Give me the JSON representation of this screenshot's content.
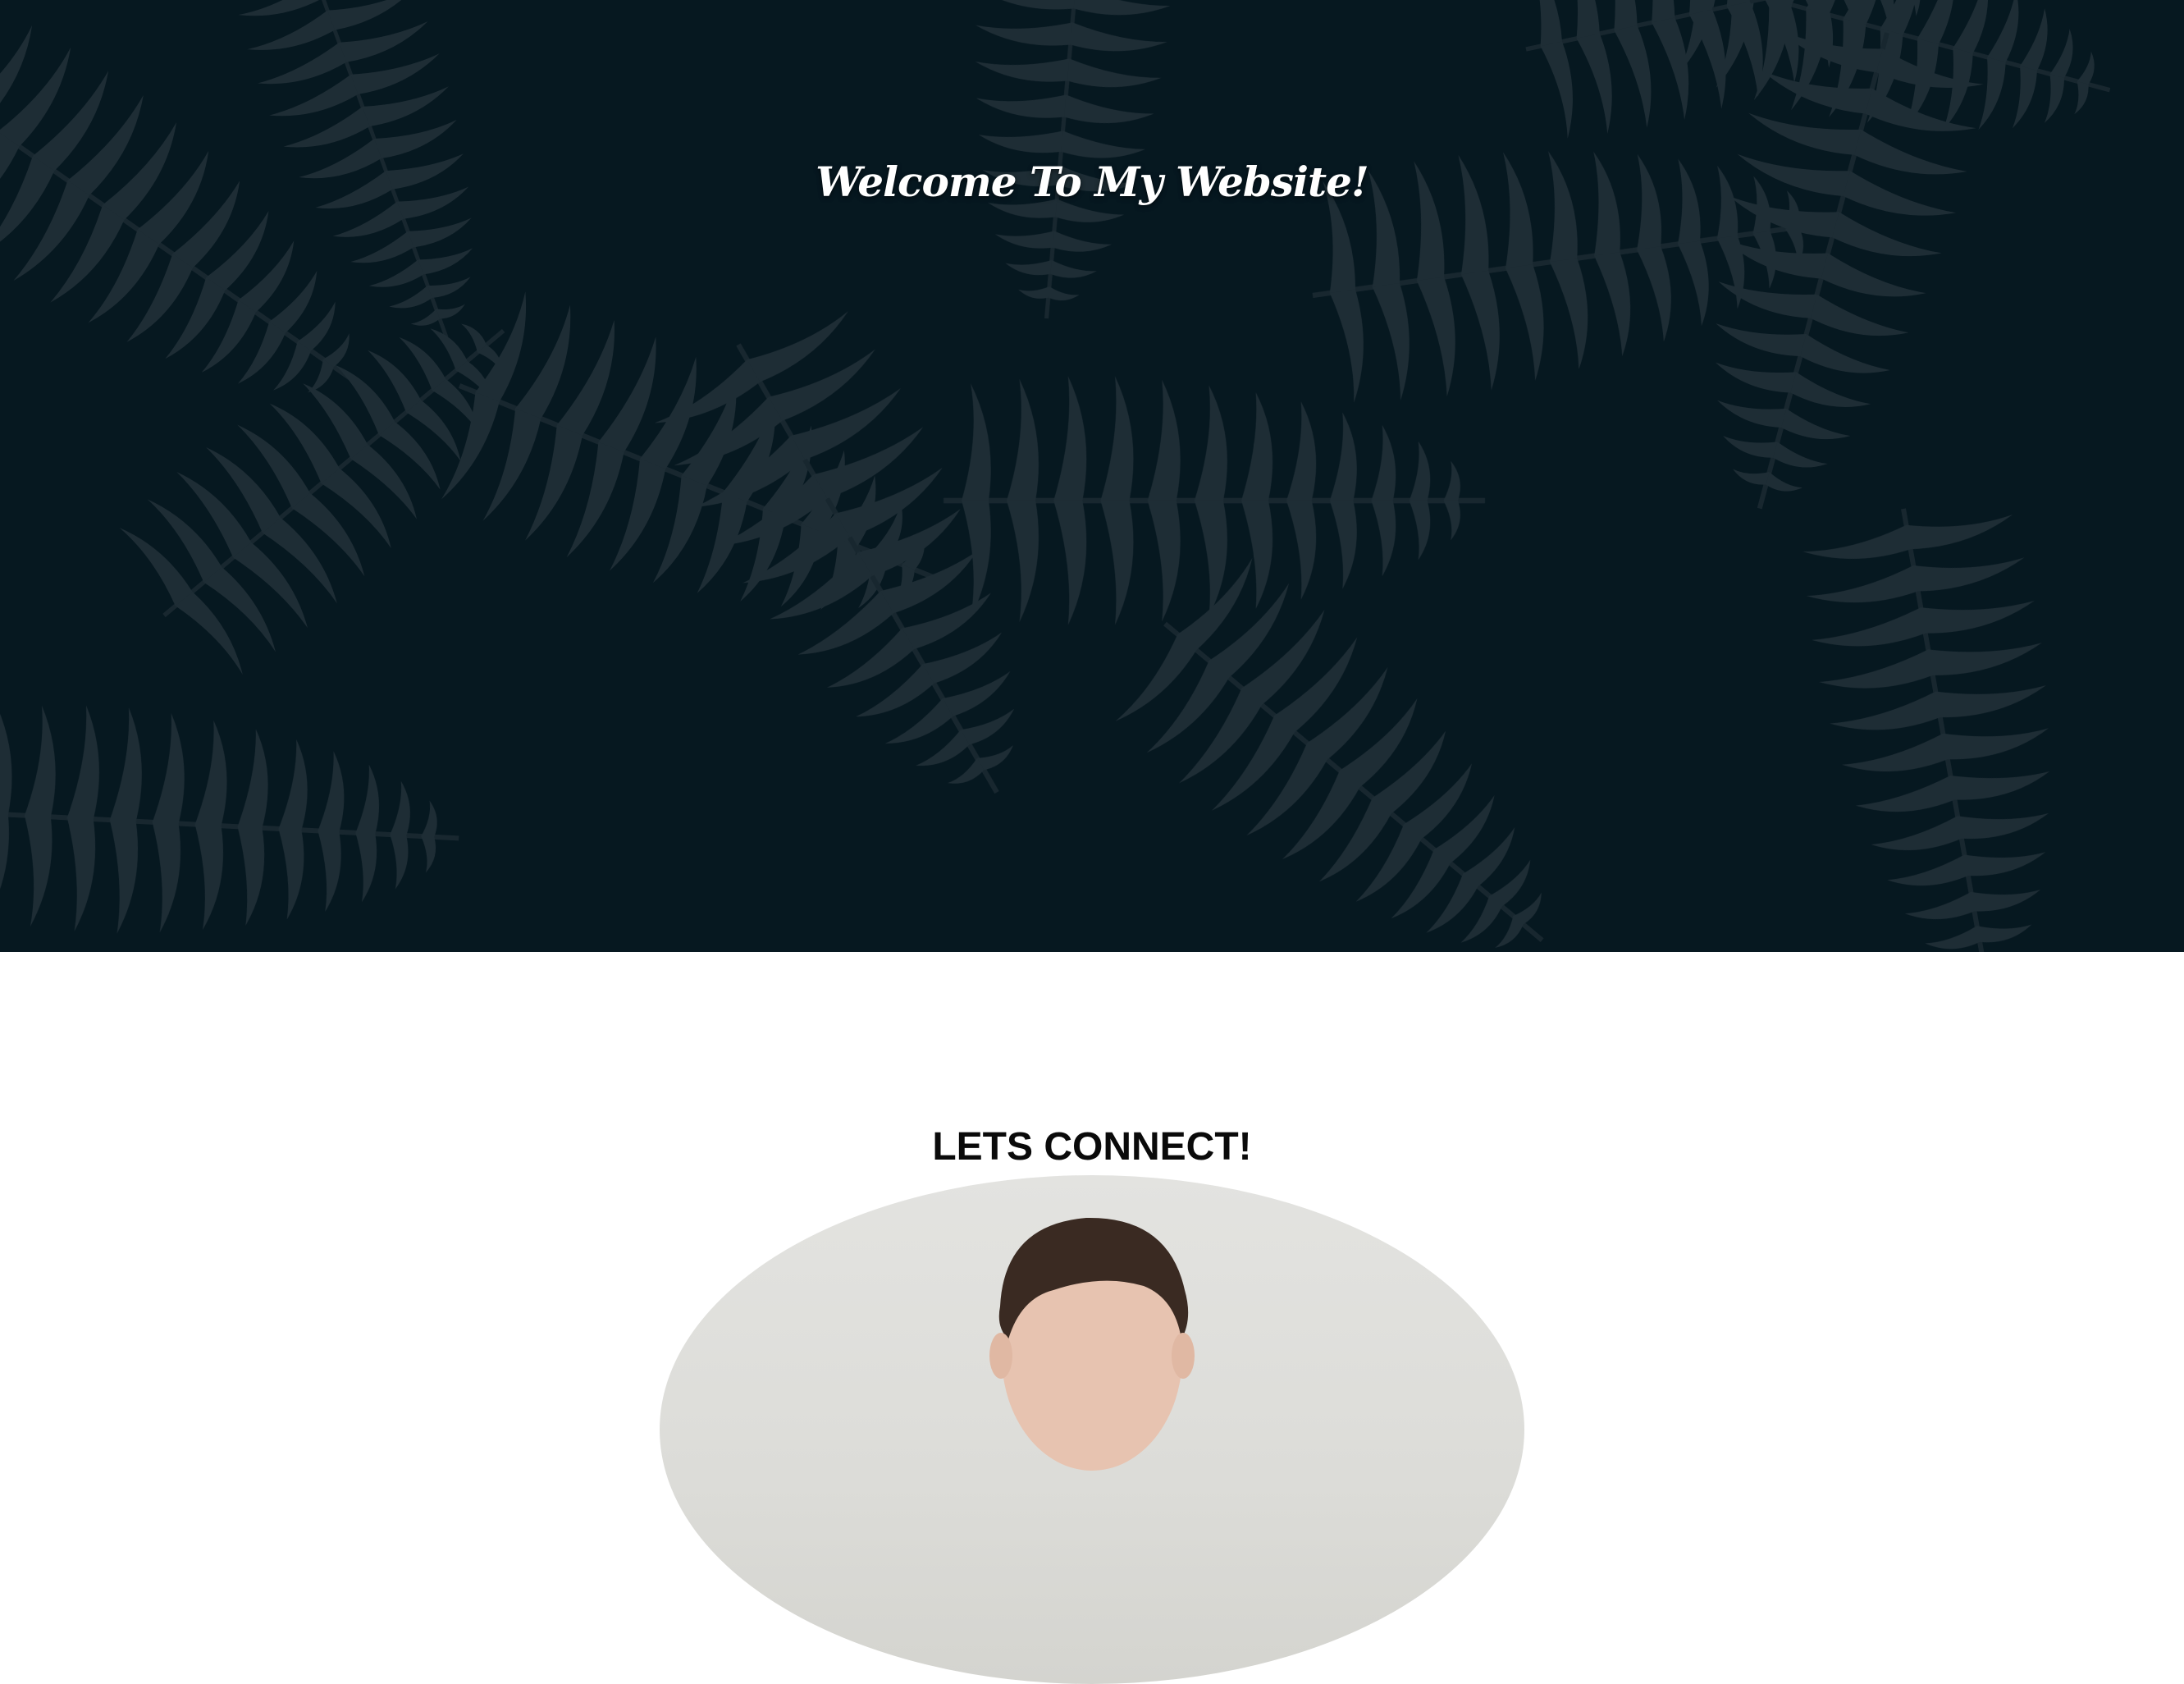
{
  "hero": {
    "title": "Welcome To My Website!",
    "background_color": "#061821",
    "leaf_color": "#2c3a41"
  },
  "connect": {
    "title": "LETS CONNECT!",
    "photo_alt": "Profile photo"
  },
  "colors": {
    "title_text": "#ffffff",
    "section_text": "#0a0a0a",
    "section_bg": "#ffffff"
  }
}
